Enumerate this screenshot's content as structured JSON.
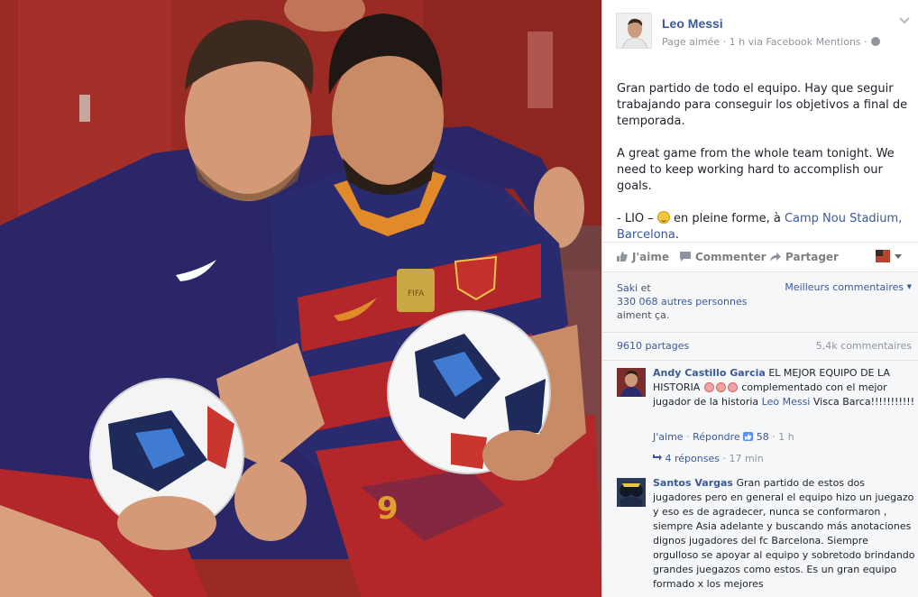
{
  "photo": {
    "ball_logo": "FIFA",
    "jersey_number": "9"
  },
  "post": {
    "author": "Leo Messi",
    "meta": "Page aimée · 1 h via Facebook Mentions ·",
    "text_fr": "Gran partido de todo el equipo. Hay que seguir trabajando para conseguir los objetivos a final de temporada.",
    "text_en": "A great game from the whole team tonight. We need to keep working hard to accomplish our goals.",
    "sig_prefix": "- LIO –",
    "sig_status": "en pleine forme, à",
    "location": "Camp Nou Stadium,",
    "city": "Barcelona",
    "city_suffix": "."
  },
  "actions": {
    "like": "J'aime",
    "comment": "Commenter",
    "share": "Partager"
  },
  "social": {
    "liker": "Saki",
    "and": "et",
    "others": "330 068 autres personnes",
    "like_suffix": "aiment ça.",
    "best_comments": "Meilleurs commentaires",
    "shares": "9610 partages",
    "comments_count": "5,4k commentaires"
  },
  "comments": [
    {
      "name": "Andy Castillo Garcia",
      "text_a": "EL MEJOR EQUIPO DE LA HISTORIA",
      "text_b": "complementado con el mejor jugador de la historia",
      "mention": "Leo Messi",
      "text_c": "Visca Barca!!!!!!!!!!!",
      "like": "J'aime",
      "sep": "·",
      "reply": "Répondre",
      "likes": "58",
      "time": "1 h",
      "replies": "4 réponses",
      "replies_time": "17 min"
    },
    {
      "name": "Santos Vargas",
      "text": "Gran partido de estos dos jugadores pero en general el equipo hizo un juegazo y eso es de agradecer, nunca se conformaron , siempre Asia adelante y buscando más anotaciones dignos jugadores del fc Barcelona. Siempre orgulloso se apoyar al equipo y sobretodo brindando grandes juegazos como estos. Es un gran equipo formado x los mejores"
    }
  ],
  "colors": {
    "link": "#3b5998",
    "meta": "#90949c",
    "jersey_blue": "#2a2a6e",
    "jersey_red": "#b3262a"
  }
}
